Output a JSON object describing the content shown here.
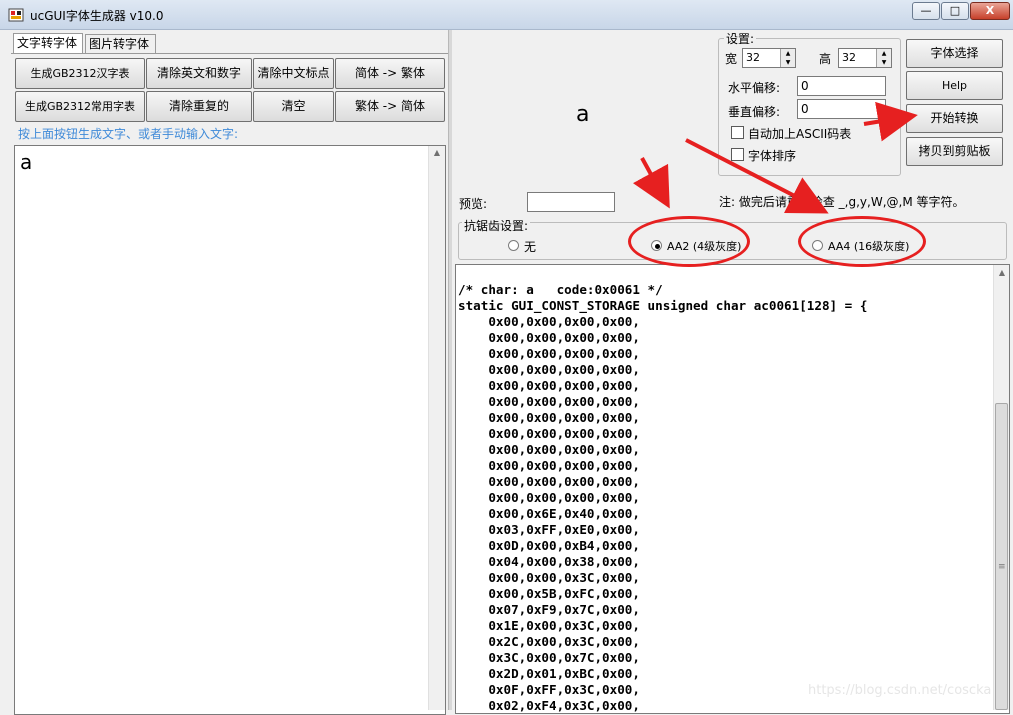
{
  "window": {
    "title": "ucGUI字体生成器 v10.0",
    "minimize": "—",
    "maximize": "□",
    "close": "X"
  },
  "tabs": [
    "文字转字体",
    "图片转字体"
  ],
  "left_buttons": {
    "row1": [
      "生成GB2312汉字表",
      "清除英文和数字",
      "清除中文标点",
      "简体 -> 繁体"
    ],
    "row2": [
      "生成GB2312常用字表",
      "清除重复的",
      "清空",
      "繁体 -> 简体"
    ]
  },
  "hint": "按上面按钮生成文字、或者手动输入文字:",
  "input_text": "a",
  "preview_char": "a",
  "settings": {
    "legend": "设置:",
    "width_label": "宽",
    "width_value": "32",
    "height_label": "高",
    "height_value": "32",
    "h_offset_label": "水平偏移:",
    "h_offset_value": "0",
    "v_offset_label": "垂直偏移:",
    "v_offset_value": "0",
    "auto_ascii_label": "自动加上ASCII码表",
    "sort_label": "字体排序"
  },
  "right_buttons": {
    "font_select": "字体选择",
    "help": "Help",
    "start": "开始转换",
    "copy": "拷贝到剪贴板"
  },
  "preview_label": "预览:",
  "note": "注: 做完后请重点检查 _,g,y,W,@,M 等字符。",
  "antialias": {
    "legend": "抗锯齿设置:",
    "options": [
      "无",
      "AA2 (4级灰度)",
      "AA4 (16级灰度)"
    ],
    "selected": "AA2 (4级灰度)"
  },
  "code_lines": [
    "/* char: a   code:0x0061 */",
    "static GUI_CONST_STORAGE unsigned char ac0061[128] = {",
    "    0x00,0x00,0x00,0x00,",
    "    0x00,0x00,0x00,0x00,",
    "    0x00,0x00,0x00,0x00,",
    "    0x00,0x00,0x00,0x00,",
    "    0x00,0x00,0x00,0x00,",
    "    0x00,0x00,0x00,0x00,",
    "    0x00,0x00,0x00,0x00,",
    "    0x00,0x00,0x00,0x00,",
    "    0x00,0x00,0x00,0x00,",
    "    0x00,0x00,0x00,0x00,",
    "    0x00,0x00,0x00,0x00,",
    "    0x00,0x00,0x00,0x00,",
    "    0x00,0x6E,0x40,0x00,",
    "    0x03,0xFF,0xE0,0x00,",
    "    0x0D,0x00,0xB4,0x00,",
    "    0x04,0x00,0x38,0x00,",
    "    0x00,0x00,0x3C,0x00,",
    "    0x00,0x5B,0xFC,0x00,",
    "    0x07,0xF9,0x7C,0x00,",
    "    0x1E,0x00,0x3C,0x00,",
    "    0x2C,0x00,0x3C,0x00,",
    "    0x3C,0x00,0x7C,0x00,",
    "    0x2D,0x01,0xBC,0x00,",
    "    0x0F,0xFF,0x3C,0x00,",
    "    0x02,0xF4,0x3C,0x00,"
  ],
  "watermark": "https://blog.csdn.net/coscka",
  "colors": {
    "annotation": "#e62020",
    "hint": "#3f8ad8"
  }
}
